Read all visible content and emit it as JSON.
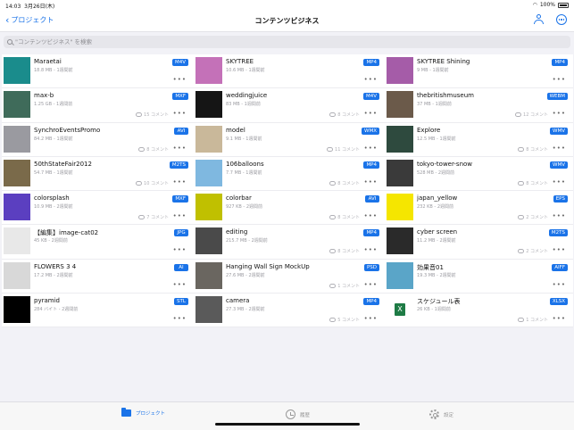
{
  "status": {
    "time": "14:03",
    "date": "3月26日(木)",
    "battery": "100%"
  },
  "nav": {
    "back_label": "プロジェクト",
    "title": "コンテンツビジネス"
  },
  "search": {
    "placeholder": "\"コンテンツビジネス\" を検索"
  },
  "items": [
    {
      "name": "Maraetai",
      "meta": "18.8 MB - 1週間前",
      "type": "M4V",
      "comments": "",
      "thumb": "#1a8c8c"
    },
    {
      "name": "SKYTREE",
      "meta": "10.6 MB - 1週間前",
      "type": "MP4",
      "comments": "",
      "thumb": "#c471b8"
    },
    {
      "name": "SKYTREE Shining",
      "meta": "9 MB - 1週間前",
      "type": "MP4",
      "comments": "",
      "thumb": "#a55ca8"
    },
    {
      "name": "max-b",
      "meta": "1.25 GB - 1週間前",
      "type": "MXF",
      "comments": "15 コメント",
      "thumb": "#3f6b5a"
    },
    {
      "name": "weddingjuice",
      "meta": "83 MB - 1週間前",
      "type": "M4V",
      "comments": "8 コメント",
      "thumb": "#151515"
    },
    {
      "name": "thebritishmuseum",
      "meta": "37 MB - 1週間前",
      "type": "WEBM",
      "comments": "12 コメント",
      "thumb": "#6b5a4a"
    },
    {
      "name": "SynchroEventsPromo",
      "meta": "84.2 MB - 1週間前",
      "type": "AVI",
      "comments": "8 コメント",
      "thumb": "#9a9aa0"
    },
    {
      "name": "model",
      "meta": "9.1 MB - 1週間前",
      "type": "WMX",
      "comments": "11 コメント",
      "thumb": "#c9b89a"
    },
    {
      "name": "Explore",
      "meta": "12.5 MB - 1週間前",
      "type": "WMV",
      "comments": "8 コメント",
      "thumb": "#2e4a3e"
    },
    {
      "name": "50thStateFair2012",
      "meta": "54.7 MB - 1週間前",
      "type": "M2TS",
      "comments": "10 コメント",
      "thumb": "#7a6a4a"
    },
    {
      "name": "106balloons",
      "meta": "7.7 MB - 1週間前",
      "type": "MP4",
      "comments": "8 コメント",
      "thumb": "#7fb8e0"
    },
    {
      "name": "tokyo-tower-snow",
      "meta": "528 MB - 2週間前",
      "type": "WMV",
      "comments": "8 コメント",
      "thumb": "#3a3a3a"
    },
    {
      "name": "colorsplash",
      "meta": "10.9 MB - 2週間前",
      "type": "MXF",
      "comments": "7 コメント",
      "thumb": "#5b3fc0"
    },
    {
      "name": "colorbar",
      "meta": "927 KB - 2週間前",
      "type": "AVI",
      "comments": "8 コメント",
      "thumb": "#c0c000"
    },
    {
      "name": "japan_yellow",
      "meta": "232 KB - 2週間前",
      "type": "EPS",
      "comments": "2 コメント",
      "thumb": "#f5e600"
    },
    {
      "name": "【編集】image-cat02",
      "meta": "45 KB - 2週間前",
      "type": "JPG",
      "comments": "",
      "thumb": "#e8e8e8"
    },
    {
      "name": "editing",
      "meta": "215.7 MB - 2週間前",
      "type": "MP4",
      "comments": "8 コメント",
      "thumb": "#4a4a4a"
    },
    {
      "name": "cyber screen",
      "meta": "11.2 MB - 2週間前",
      "type": "M2TS",
      "comments": "2 コメント",
      "thumb": "#2a2a2a"
    },
    {
      "name": "FLOWERS 3 4",
      "meta": "17.2 MB - 2週間前",
      "type": "AI",
      "comments": "",
      "thumb": "#d8d8d8"
    },
    {
      "name": "Hanging Wall Sign MockUp",
      "meta": "27.6 MB - 2週間前",
      "type": "PSD",
      "comments": "1 コメント",
      "thumb": "#6a6660"
    },
    {
      "name": "効果音01",
      "meta": "19.3 MB - 2週間前",
      "type": "AIFF",
      "comments": "",
      "thumb": "#5aa5c8"
    },
    {
      "name": "pyramid",
      "meta": "284 バイト - 2週間前",
      "type": "STL",
      "comments": "",
      "thumb": "#000000"
    },
    {
      "name": "camera",
      "meta": "27.3 MB - 2週間前",
      "type": "MP4",
      "comments": "5 コメント",
      "thumb": "#5a5a5a"
    },
    {
      "name": "スケジュール表",
      "meta": "26 KB - 1週間前",
      "type": "XLSX",
      "comments": "1 コメント",
      "thumb": "#ffffff"
    }
  ],
  "tabs": {
    "projects": "プロジェクト",
    "history": "履歴",
    "settings": "設定"
  },
  "colors": {
    "accent": "#1a73e8"
  }
}
